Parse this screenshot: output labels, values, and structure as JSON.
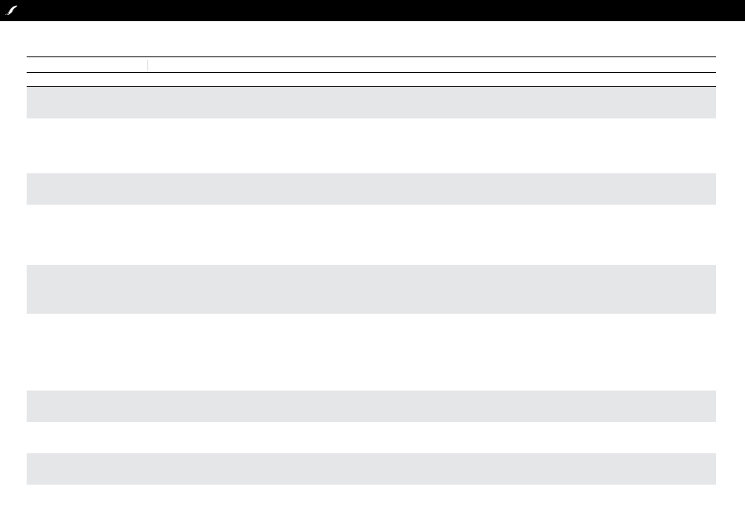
{
  "app": {
    "logo": "stroke-brand-icon"
  },
  "colors": {
    "topbar": "#000000",
    "band": "#e5e6e8",
    "rule": "#000000",
    "background": "#ffffff"
  },
  "table": {
    "columns": [
      "",
      ""
    ],
    "rows": [
      {
        "shade": "band",
        "cells": [
          "",
          ""
        ]
      },
      {
        "shade": "white",
        "cells": [
          "",
          ""
        ]
      },
      {
        "shade": "band",
        "cells": [
          "",
          ""
        ]
      },
      {
        "shade": "white",
        "cells": [
          "",
          ""
        ]
      },
      {
        "shade": "band",
        "cells": [
          "",
          ""
        ]
      },
      {
        "shade": "white",
        "cells": [
          "",
          ""
        ]
      },
      {
        "shade": "band",
        "cells": [
          "",
          ""
        ]
      },
      {
        "shade": "white",
        "cells": [
          "",
          ""
        ]
      },
      {
        "shade": "band",
        "cells": [
          "",
          ""
        ]
      }
    ]
  }
}
